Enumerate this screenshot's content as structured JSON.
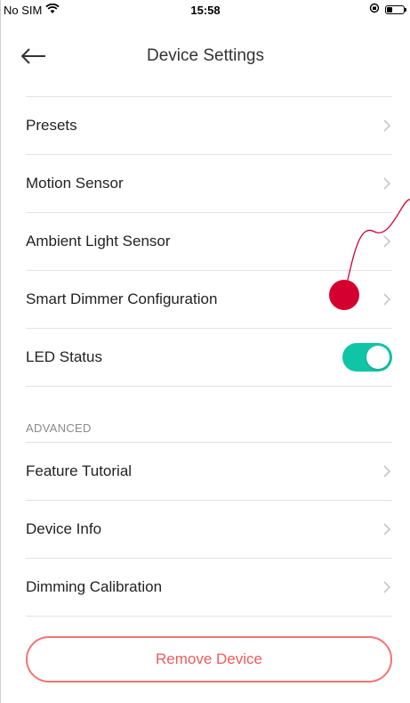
{
  "status_bar": {
    "carrier": "No SIM",
    "time": "15:58",
    "battery_level": 0.35
  },
  "header": {
    "title": "Device Settings"
  },
  "settings": {
    "items": [
      {
        "label": "Presets"
      },
      {
        "label": "Motion Sensor"
      },
      {
        "label": "Ambient Light Sensor"
      },
      {
        "label": "Smart Dimmer Configuration"
      }
    ],
    "led_status": {
      "label": "LED Status",
      "enabled": true
    }
  },
  "advanced": {
    "section_title": "ADVANCED",
    "items": [
      {
        "label": "Feature Tutorial"
      },
      {
        "label": "Device Info"
      },
      {
        "label": "Dimming Calibration"
      }
    ]
  },
  "actions": {
    "remove_label": "Remove Device"
  },
  "colors": {
    "accent_toggle": "#10c5a6",
    "danger": "#ef5b5b",
    "annotation_marker": "#d4002f"
  }
}
